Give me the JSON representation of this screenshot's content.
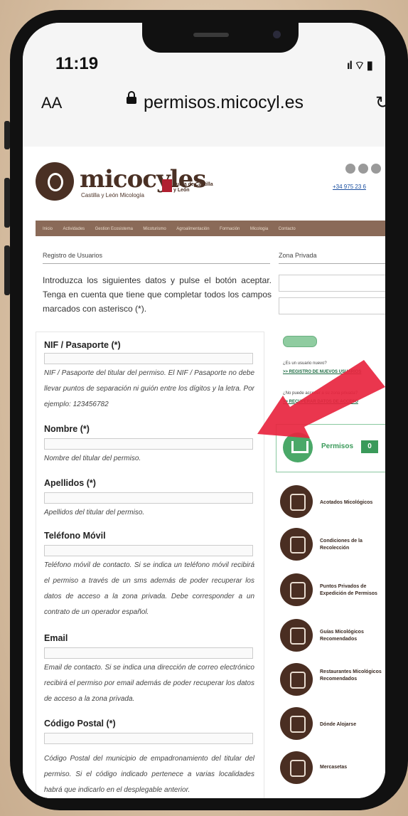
{
  "status": {
    "time": "11:19",
    "signal": "..ıl"
  },
  "browser": {
    "aa_label": "AA",
    "url": "permisos.micocyl.es",
    "reload": "↻"
  },
  "header": {
    "brand": "micocyles",
    "brand_sub": "Castilla y León Micología",
    "junta": "Junta de Castilla y León",
    "phone": "+34 975 23 6"
  },
  "nav": [
    "Inicio",
    "Actividades",
    "Gestion Ecosistema",
    "Micoturismo",
    "Agroalimentación",
    "Formación",
    "Micologia",
    "Contacto"
  ],
  "main": {
    "breadcrumb": "Registro de Usuarios",
    "intro": "Introduzca los siguientes datos y pulse el botón aceptar. Tenga en cuenta que tiene que completar todos los campos marcados con asterisco (*).",
    "fields": [
      {
        "label": "NIF / Pasaporte (*)",
        "help": "NIF / Pasaporte del titular del permiso. El NIF / Pasaporte no debe llevar puntos de separación ni guión entre los dígitos y la letra. Por ejemplo: 123456782"
      },
      {
        "label": "Nombre (*)",
        "help": "Nombre del titular del permiso."
      },
      {
        "label": "Apellidos (*)",
        "help": "Apellidos del titular del permiso."
      },
      {
        "label": "Teléfono Móvil",
        "help": "Teléfono móvil de contacto. Si se indica un teléfono móvil recibirá el permiso a través de un sms además de poder recuperar los datos de acceso a la zona privada. Debe corresponder a un contrato de un operador español."
      },
      {
        "label": "Email",
        "help": "Email de contacto. Si se indica una dirección de correo electrónico recibirá el permiso por email además de poder recuperar los datos de acceso a la zona privada."
      },
      {
        "label": "Código Postal (*)",
        "help": "Código Postal del municipio de empadronamiento del titular del permiso. Si el código indicado pertenece a varias localidades habrá que indicarlo en el desplegable anterior."
      }
    ]
  },
  "side": {
    "heading": "Zona Privada",
    "q1": "¿Es un usuario nuevo?",
    "l1": ">> REGISTRO DE NUEVOS USUARIOS",
    "q2": "¿No puede acceder a su zona privada?",
    "l2": ">> RECUPERAR DATOS DE ACCESO",
    "cart_label": "Permisos",
    "cart_count": "0",
    "menu": [
      "Acotados Micológicos",
      "Condiciones de la Recolección",
      "Puntos Privados de Expedición de Permisos",
      "Guías Micológicos Recomendados",
      "Restaurantes Micológicos Recomendados",
      "Dónde Alojarse",
      "Mercasetas"
    ]
  }
}
